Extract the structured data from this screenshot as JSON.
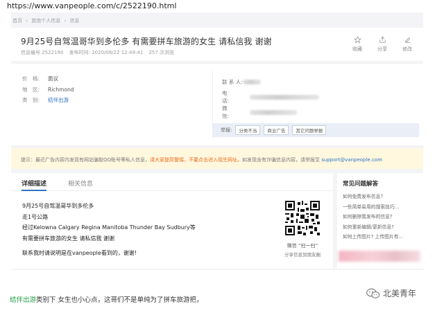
{
  "url": "https://www.vanpeople.com/c/2522190.html",
  "breadcrumb": [
    "首页",
    "›",
    "其他个人信息",
    "›",
    "信息"
  ],
  "post": {
    "title": "9月25号自驾温哥华到多伦多 有需要拼车旅游的女生 请私信我 谢谢",
    "info_id": "信息编号 2522190",
    "published": "发布时间: 2020/08/22 12:49:41",
    "views": "257 次浏览"
  },
  "actions": [
    {
      "label": "收藏",
      "icon": "star-icon"
    },
    {
      "label": "分享",
      "icon": "share-icon"
    },
    {
      "label": "修改",
      "icon": "edit-icon"
    }
  ],
  "info": [
    {
      "label": "价　格:",
      "value": "面议",
      "link": false
    },
    {
      "label": "地　区:",
      "value": "Richmond",
      "link": false
    },
    {
      "label": "类　别:",
      "value": "结伴出游",
      "link": true
    }
  ],
  "contact": {
    "person_label": "联 系 人:",
    "phone_label": "电　　话:",
    "wechat_label": "微　　信:"
  },
  "report": {
    "label": "举报:",
    "buttons": [
      "分类不当",
      "商业广告",
      "其它问题举报"
    ]
  },
  "notice": {
    "prefix": "提示：最近广告内容内发现有网站骗取QQ账号等私人信息，",
    "warn": "请大家提高警惕，不要点击进入陌生网址。",
    "middle": "如发现含有诈骗信息内容，请举报至 ",
    "email": "support@vanpeople.com"
  },
  "tabs": {
    "active": "详细描述",
    "inactive": "相关信息"
  },
  "detail": {
    "line1": "9月25号自驾温哥华到多伦多",
    "line2": "走1号公路",
    "line3": "经过Kelowna Calgary Regina Manitoba Thunder Bay Sudbury等",
    "line4": "有需要拼车旅游的女生 请私信我 谢谢",
    "line5": "联系我时请说明是在vanpeople看到的，谢谢!"
  },
  "qr": {
    "caption1": "微信 “扫一扫”",
    "caption2": "分享信息到朋友圈"
  },
  "faq": {
    "title": "常见问题解答",
    "items": [
      "如何免费发布信息?",
      "一些简单易用的搜索技巧...",
      "如何删除我发布的信息?",
      "如何重新编辑/更新信息?",
      "如何上传图片? 上传图片有..."
    ]
  },
  "bottom": {
    "link": "结伴出游",
    "text": "类别下 女生也小心点，这哥们不是单纯为了拼车旅游把，"
  },
  "watermark": "北美青年"
}
